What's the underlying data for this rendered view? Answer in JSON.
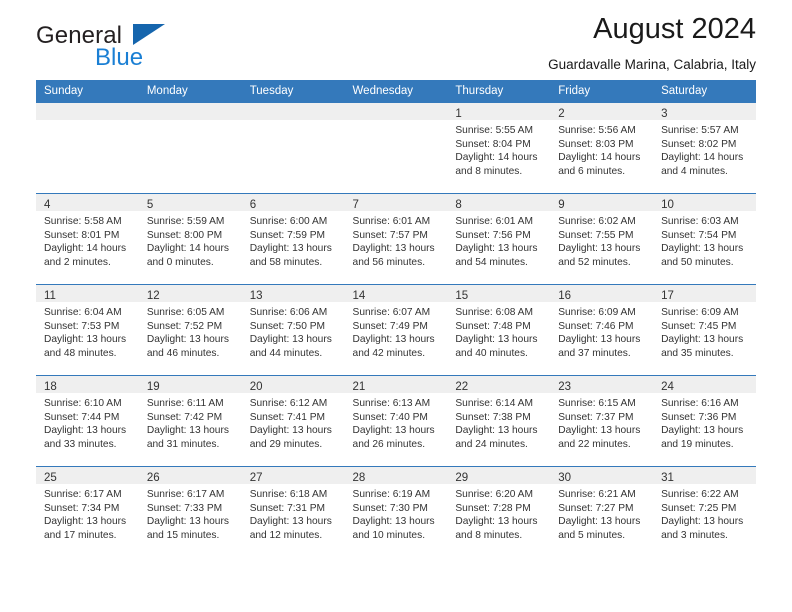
{
  "brand": {
    "name_top": "General",
    "name_bottom": "Blue",
    "accent_color": "#1a7fd4",
    "triangle_color": "#1565ad"
  },
  "header": {
    "title": "August 2024",
    "subtitle": "Guardavalle Marina, Calabria, Italy"
  },
  "calendar": {
    "header_background": "#3479bb",
    "header_text_color": "#ffffff",
    "daynum_background": "#efefef",
    "weekday_headers": [
      "Sunday",
      "Monday",
      "Tuesday",
      "Wednesday",
      "Thursday",
      "Friday",
      "Saturday"
    ],
    "weeks": [
      [
        {
          "day": "",
          "empty": true
        },
        {
          "day": "",
          "empty": true
        },
        {
          "day": "",
          "empty": true
        },
        {
          "day": "",
          "empty": true
        },
        {
          "day": "1",
          "sunrise": "Sunrise: 5:55 AM",
          "sunset": "Sunset: 8:04 PM",
          "daylight_1": "Daylight: 14 hours",
          "daylight_2": "and 8 minutes."
        },
        {
          "day": "2",
          "sunrise": "Sunrise: 5:56 AM",
          "sunset": "Sunset: 8:03 PM",
          "daylight_1": "Daylight: 14 hours",
          "daylight_2": "and 6 minutes."
        },
        {
          "day": "3",
          "sunrise": "Sunrise: 5:57 AM",
          "sunset": "Sunset: 8:02 PM",
          "daylight_1": "Daylight: 14 hours",
          "daylight_2": "and 4 minutes."
        }
      ],
      [
        {
          "day": "4",
          "sunrise": "Sunrise: 5:58 AM",
          "sunset": "Sunset: 8:01 PM",
          "daylight_1": "Daylight: 14 hours",
          "daylight_2": "and 2 minutes."
        },
        {
          "day": "5",
          "sunrise": "Sunrise: 5:59 AM",
          "sunset": "Sunset: 8:00 PM",
          "daylight_1": "Daylight: 14 hours",
          "daylight_2": "and 0 minutes."
        },
        {
          "day": "6",
          "sunrise": "Sunrise: 6:00 AM",
          "sunset": "Sunset: 7:59 PM",
          "daylight_1": "Daylight: 13 hours",
          "daylight_2": "and 58 minutes."
        },
        {
          "day": "7",
          "sunrise": "Sunrise: 6:01 AM",
          "sunset": "Sunset: 7:57 PM",
          "daylight_1": "Daylight: 13 hours",
          "daylight_2": "and 56 minutes."
        },
        {
          "day": "8",
          "sunrise": "Sunrise: 6:01 AM",
          "sunset": "Sunset: 7:56 PM",
          "daylight_1": "Daylight: 13 hours",
          "daylight_2": "and 54 minutes."
        },
        {
          "day": "9",
          "sunrise": "Sunrise: 6:02 AM",
          "sunset": "Sunset: 7:55 PM",
          "daylight_1": "Daylight: 13 hours",
          "daylight_2": "and 52 minutes."
        },
        {
          "day": "10",
          "sunrise": "Sunrise: 6:03 AM",
          "sunset": "Sunset: 7:54 PM",
          "daylight_1": "Daylight: 13 hours",
          "daylight_2": "and 50 minutes."
        }
      ],
      [
        {
          "day": "11",
          "sunrise": "Sunrise: 6:04 AM",
          "sunset": "Sunset: 7:53 PM",
          "daylight_1": "Daylight: 13 hours",
          "daylight_2": "and 48 minutes."
        },
        {
          "day": "12",
          "sunrise": "Sunrise: 6:05 AM",
          "sunset": "Sunset: 7:52 PM",
          "daylight_1": "Daylight: 13 hours",
          "daylight_2": "and 46 minutes."
        },
        {
          "day": "13",
          "sunrise": "Sunrise: 6:06 AM",
          "sunset": "Sunset: 7:50 PM",
          "daylight_1": "Daylight: 13 hours",
          "daylight_2": "and 44 minutes."
        },
        {
          "day": "14",
          "sunrise": "Sunrise: 6:07 AM",
          "sunset": "Sunset: 7:49 PM",
          "daylight_1": "Daylight: 13 hours",
          "daylight_2": "and 42 minutes."
        },
        {
          "day": "15",
          "sunrise": "Sunrise: 6:08 AM",
          "sunset": "Sunset: 7:48 PM",
          "daylight_1": "Daylight: 13 hours",
          "daylight_2": "and 40 minutes."
        },
        {
          "day": "16",
          "sunrise": "Sunrise: 6:09 AM",
          "sunset": "Sunset: 7:46 PM",
          "daylight_1": "Daylight: 13 hours",
          "daylight_2": "and 37 minutes."
        },
        {
          "day": "17",
          "sunrise": "Sunrise: 6:09 AM",
          "sunset": "Sunset: 7:45 PM",
          "daylight_1": "Daylight: 13 hours",
          "daylight_2": "and 35 minutes."
        }
      ],
      [
        {
          "day": "18",
          "sunrise": "Sunrise: 6:10 AM",
          "sunset": "Sunset: 7:44 PM",
          "daylight_1": "Daylight: 13 hours",
          "daylight_2": "and 33 minutes."
        },
        {
          "day": "19",
          "sunrise": "Sunrise: 6:11 AM",
          "sunset": "Sunset: 7:42 PM",
          "daylight_1": "Daylight: 13 hours",
          "daylight_2": "and 31 minutes."
        },
        {
          "day": "20",
          "sunrise": "Sunrise: 6:12 AM",
          "sunset": "Sunset: 7:41 PM",
          "daylight_1": "Daylight: 13 hours",
          "daylight_2": "and 29 minutes."
        },
        {
          "day": "21",
          "sunrise": "Sunrise: 6:13 AM",
          "sunset": "Sunset: 7:40 PM",
          "daylight_1": "Daylight: 13 hours",
          "daylight_2": "and 26 minutes."
        },
        {
          "day": "22",
          "sunrise": "Sunrise: 6:14 AM",
          "sunset": "Sunset: 7:38 PM",
          "daylight_1": "Daylight: 13 hours",
          "daylight_2": "and 24 minutes."
        },
        {
          "day": "23",
          "sunrise": "Sunrise: 6:15 AM",
          "sunset": "Sunset: 7:37 PM",
          "daylight_1": "Daylight: 13 hours",
          "daylight_2": "and 22 minutes."
        },
        {
          "day": "24",
          "sunrise": "Sunrise: 6:16 AM",
          "sunset": "Sunset: 7:36 PM",
          "daylight_1": "Daylight: 13 hours",
          "daylight_2": "and 19 minutes."
        }
      ],
      [
        {
          "day": "25",
          "sunrise": "Sunrise: 6:17 AM",
          "sunset": "Sunset: 7:34 PM",
          "daylight_1": "Daylight: 13 hours",
          "daylight_2": "and 17 minutes."
        },
        {
          "day": "26",
          "sunrise": "Sunrise: 6:17 AM",
          "sunset": "Sunset: 7:33 PM",
          "daylight_1": "Daylight: 13 hours",
          "daylight_2": "and 15 minutes."
        },
        {
          "day": "27",
          "sunrise": "Sunrise: 6:18 AM",
          "sunset": "Sunset: 7:31 PM",
          "daylight_1": "Daylight: 13 hours",
          "daylight_2": "and 12 minutes."
        },
        {
          "day": "28",
          "sunrise": "Sunrise: 6:19 AM",
          "sunset": "Sunset: 7:30 PM",
          "daylight_1": "Daylight: 13 hours",
          "daylight_2": "and 10 minutes."
        },
        {
          "day": "29",
          "sunrise": "Sunrise: 6:20 AM",
          "sunset": "Sunset: 7:28 PM",
          "daylight_1": "Daylight: 13 hours",
          "daylight_2": "and 8 minutes."
        },
        {
          "day": "30",
          "sunrise": "Sunrise: 6:21 AM",
          "sunset": "Sunset: 7:27 PM",
          "daylight_1": "Daylight: 13 hours",
          "daylight_2": "and 5 minutes."
        },
        {
          "day": "31",
          "sunrise": "Sunrise: 6:22 AM",
          "sunset": "Sunset: 7:25 PM",
          "daylight_1": "Daylight: 13 hours",
          "daylight_2": "and 3 minutes."
        }
      ]
    ]
  }
}
